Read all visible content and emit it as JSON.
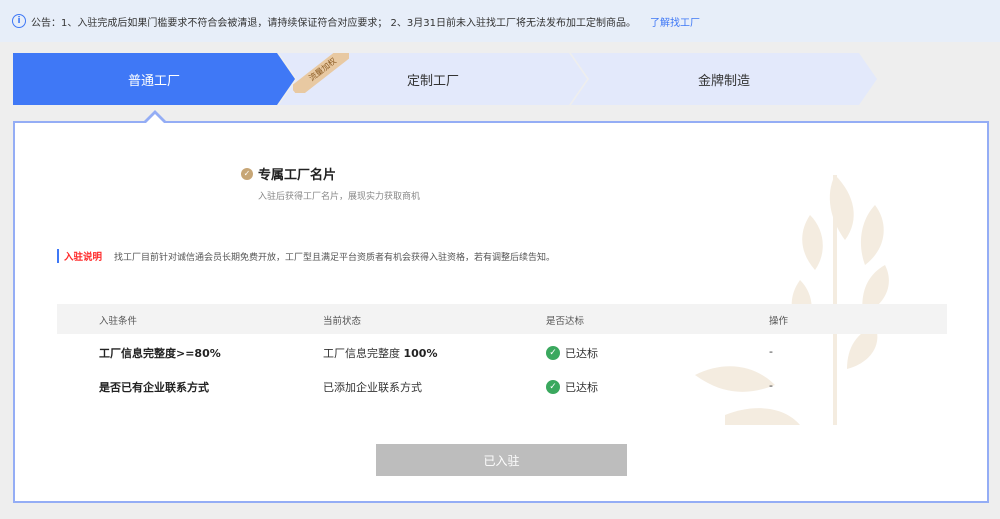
{
  "notice": {
    "text": "公告：1、入驻完成后如果门槛要求不符合会被清退，请持续保证符合对应要求； 2、3月31日前未入驻找工厂将无法发布加工定制商品。",
    "link": "了解找工厂"
  },
  "steps": [
    {
      "label": "普通工厂",
      "active": true
    },
    {
      "label": "定制工厂",
      "active": false
    },
    {
      "label": "金牌制造",
      "active": false
    }
  ],
  "ribbon": "流量加权",
  "feature": {
    "title": "专属工厂名片",
    "subtitle": "入驻后获得工厂名片，展现实力获取商机"
  },
  "intro": {
    "label": "入驻说明",
    "text": "找工厂目前针对诚信通会员长期免费开放，工厂型且满足平台资质者有机会获得入驻资格，若有调整后续告知。"
  },
  "table": {
    "headers": [
      "入驻条件",
      "当前状态",
      "是否达标",
      "操作"
    ],
    "rows": [
      {
        "condition": "工厂信息完整度>=80%",
        "status_prefix": "工厂信息完整度",
        "status_value": "100%",
        "met": "已达标",
        "action": "-"
      },
      {
        "condition": "是否已有企业联系方式",
        "status_prefix": "已添加企业联系方式",
        "status_value": "",
        "met": "已达标",
        "action": "-"
      }
    ]
  },
  "button": "已入驻",
  "colors": {
    "accent": "#3f78f6",
    "success": "#3aa85e",
    "warning": "#ff2a2a",
    "gold": "#c7a676"
  }
}
